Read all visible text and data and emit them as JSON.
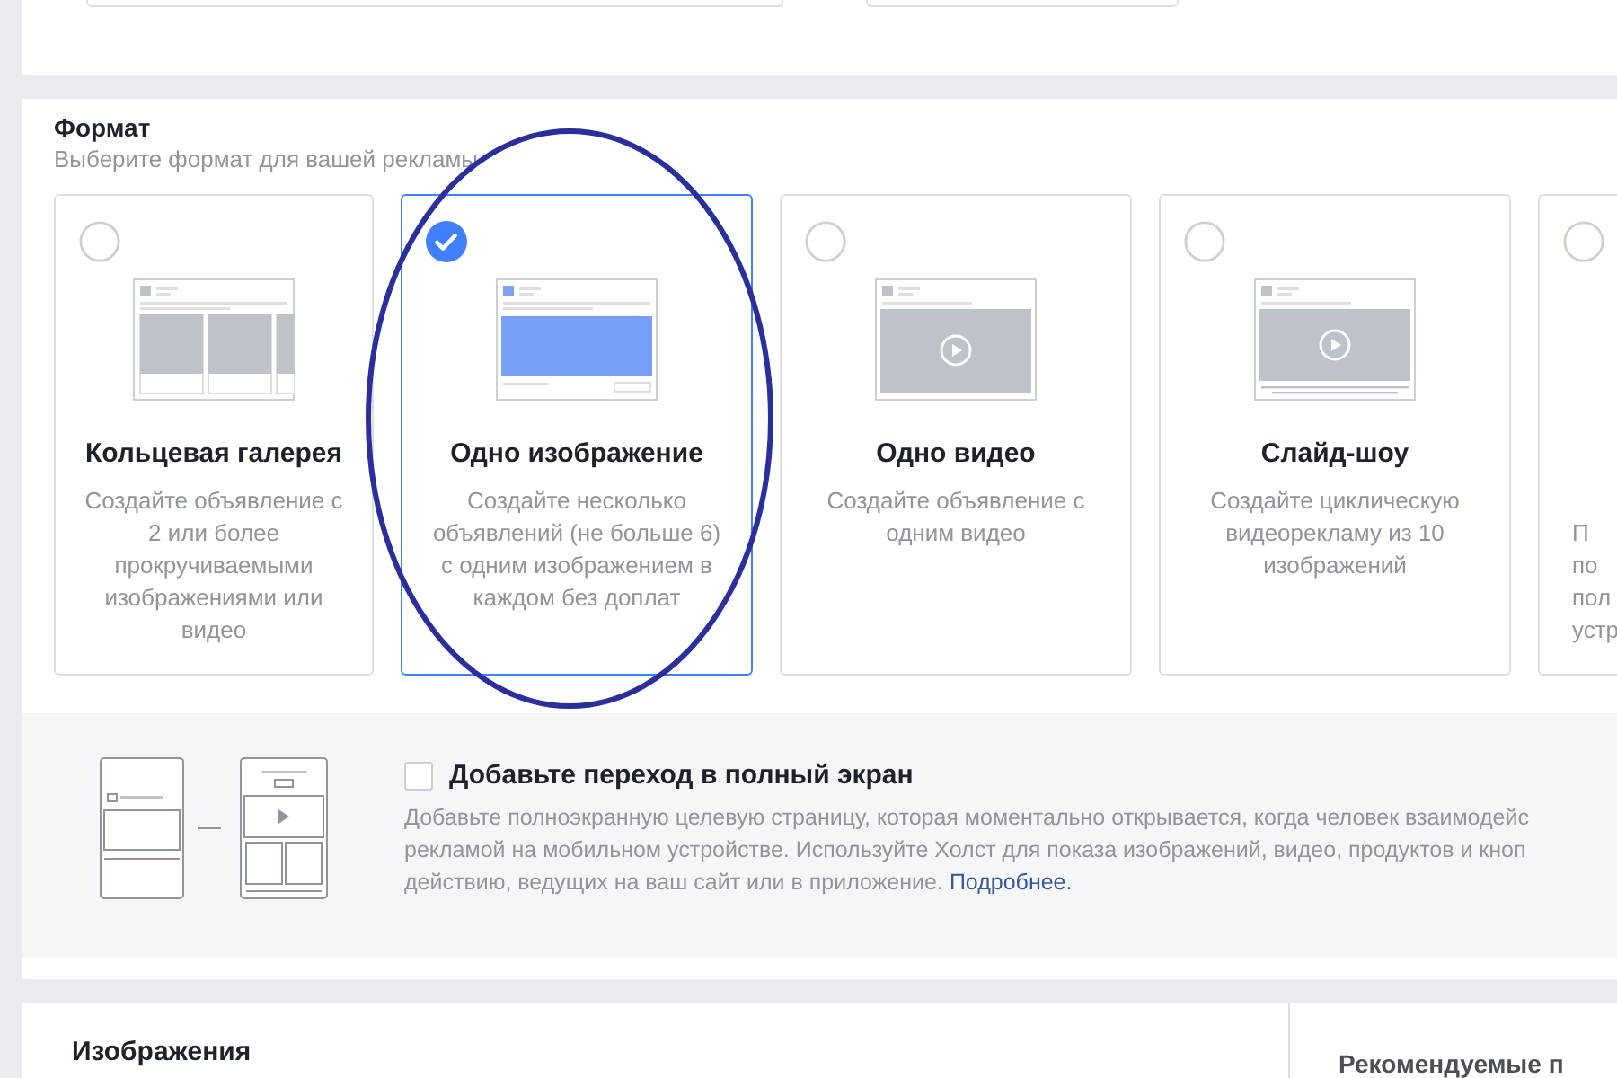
{
  "format": {
    "title": "Формат",
    "subtitle": "Выберите формат для вашей рекламы",
    "cards": [
      {
        "kind": "carousel",
        "title": "Кольцевая галерея",
        "lines": [
          "Создайте объявление с",
          "2 или более",
          "прокручиваемыми",
          "изображениями или",
          "видео"
        ],
        "selected": false,
        "circled": false
      },
      {
        "kind": "image",
        "title": "Одно изображение",
        "lines": [
          "Создайте несколько",
          "объявлений (не больше 6)",
          "с одним изображением в",
          "каждом без доплат"
        ],
        "selected": true,
        "circled": true
      },
      {
        "kind": "video",
        "title": "Одно видео",
        "lines": [
          "Создайте объявление с",
          "одним видео"
        ],
        "selected": false,
        "circled": false
      },
      {
        "kind": "slideshow",
        "title": "Слайд-шоу",
        "lines": [
          "Создайте циклическую",
          "видеорекламу из 10",
          "изображений"
        ],
        "selected": false,
        "circled": false
      },
      {
        "kind": "partial",
        "lines": [
          "П",
          "по",
          "пол",
          "устр"
        ],
        "selected": false,
        "circled": false
      }
    ]
  },
  "fullscreen": {
    "checked": false,
    "title": "Добавьте переход в полный экран",
    "lines": [
      "Добавьте полноэкранную целевую страницу, которая моментально открывается, когда человек взаимодейс",
      "рекламой на мобильном устройстве. Используйте Холст для показа изображений, видео, продуктов и кноп",
      "действию, ведущих на ваш сайт или в приложение."
    ],
    "link": "Подробнее."
  },
  "images": {
    "title": "Изображения",
    "side_title": "Рекомендуемые п"
  }
}
